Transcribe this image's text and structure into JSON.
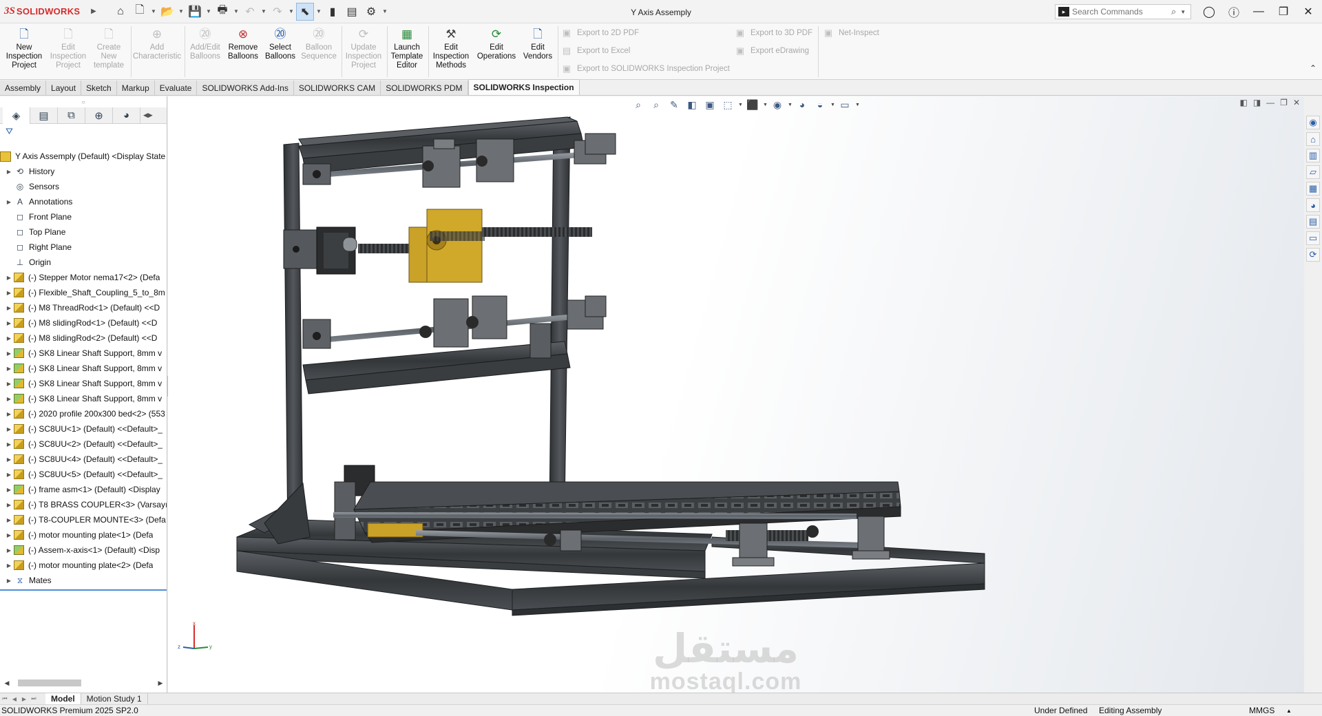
{
  "app": {
    "brand_ds": "3S",
    "brand_name": "SOLIDWORKS",
    "document_title": "Y Axis Assemply"
  },
  "search": {
    "placeholder": "Search Commands"
  },
  "ribbon": {
    "buttons": [
      {
        "label": "New Inspection Project",
        "icon": "new-inspection-project-icon",
        "enabled": true
      },
      {
        "label": "Edit Inspection Project",
        "icon": "edit-inspection-project-icon",
        "enabled": false
      },
      {
        "label": "Create New template",
        "icon": "create-template-icon",
        "enabled": false
      },
      {
        "label": "Add Characteristic",
        "icon": "add-characteristic-icon",
        "enabled": false
      },
      {
        "label": "Add/Edit Balloons",
        "icon": "balloon-icon",
        "enabled": false
      },
      {
        "label": "Remove Balloons",
        "icon": "remove-balloons-icon",
        "enabled": true
      },
      {
        "label": "Select Balloons",
        "icon": "select-balloons-icon",
        "enabled": true
      },
      {
        "label": "Balloon Sequence",
        "icon": "balloon-sequence-icon",
        "enabled": false
      },
      {
        "label": "Update Inspection Project",
        "icon": "update-project-icon",
        "enabled": false
      },
      {
        "label": "Launch Template Editor",
        "icon": "template-editor-icon",
        "enabled": true
      },
      {
        "label": "Edit Inspection Methods",
        "icon": "inspection-methods-icon",
        "enabled": true
      },
      {
        "label": "Edit Operations",
        "icon": "operations-icon",
        "enabled": true
      },
      {
        "label": "Edit Vendors",
        "icon": "vendors-icon",
        "enabled": true
      }
    ],
    "exports_col1": [
      "Export to 2D PDF",
      "Export to Excel",
      "Export to SOLIDWORKS Inspection Project"
    ],
    "exports_col2": [
      "Export to 3D PDF",
      "Export eDrawing"
    ],
    "net_inspect": "Net-Inspect"
  },
  "command_tabs": [
    "Assembly",
    "Layout",
    "Sketch",
    "Markup",
    "Evaluate",
    "SOLIDWORKS Add-Ins",
    "SOLIDWORKS CAM",
    "SOLIDWORKS PDM",
    "SOLIDWORKS Inspection"
  ],
  "active_command_tab": "SOLIDWORKS Inspection",
  "feature_tree": {
    "root": "Y Axis Assemply (Default) <Display State",
    "items": [
      {
        "label": "History",
        "icon": "history-icon",
        "expand": true,
        "type": "folder"
      },
      {
        "label": "Sensors",
        "icon": "sensor-icon",
        "expand": false,
        "type": "folder"
      },
      {
        "label": "Annotations",
        "icon": "annotation-icon",
        "expand": true,
        "type": "folder"
      },
      {
        "label": "Front Plane",
        "icon": "plane-icon",
        "expand": false,
        "type": "plane"
      },
      {
        "label": "Top Plane",
        "icon": "plane-icon",
        "expand": false,
        "type": "plane"
      },
      {
        "label": "Right Plane",
        "icon": "plane-icon",
        "expand": false,
        "type": "plane"
      },
      {
        "label": "Origin",
        "icon": "origin-icon",
        "expand": false,
        "type": "origin"
      },
      {
        "label": "(-) Stepper Motor nema17<2> (Defa",
        "icon": "assembly-icon",
        "expand": true,
        "type": "asm"
      },
      {
        "label": "(-) Flexible_Shaft_Coupling_5_to_8m",
        "icon": "part-icon",
        "expand": true,
        "type": "asm"
      },
      {
        "label": "(-) M8 ThreadRod<1> (Default) <<D",
        "icon": "part-icon",
        "expand": true,
        "type": "asm"
      },
      {
        "label": "(-) M8 slidingRod<1> (Default) <<D",
        "icon": "part-icon",
        "expand": true,
        "type": "asm"
      },
      {
        "label": "(-) M8 slidingRod<2> (Default) <<D",
        "icon": "part-icon",
        "expand": true,
        "type": "asm"
      },
      {
        "label": "(-) SK8 Linear Shaft Support, 8mm v",
        "icon": "assembly-icon",
        "expand": true,
        "type": "asmg"
      },
      {
        "label": "(-) SK8 Linear Shaft Support, 8mm v",
        "icon": "assembly-icon",
        "expand": true,
        "type": "asmg"
      },
      {
        "label": "(-) SK8 Linear Shaft Support, 8mm v",
        "icon": "assembly-icon",
        "expand": true,
        "type": "asmg"
      },
      {
        "label": "(-) SK8 Linear Shaft Support, 8mm v",
        "icon": "assembly-icon",
        "expand": true,
        "type": "asmg"
      },
      {
        "label": "(-) 2020 profile 200x300 bed<2> (553",
        "icon": "part-icon",
        "expand": true,
        "type": "asm"
      },
      {
        "label": "(-) SC8UU<1> (Default) <<Default>_",
        "icon": "part-icon",
        "expand": true,
        "type": "asm"
      },
      {
        "label": "(-) SC8UU<2> (Default) <<Default>_",
        "icon": "part-icon",
        "expand": true,
        "type": "asm"
      },
      {
        "label": "(-) SC8UU<4> (Default) <<Default>_",
        "icon": "part-icon",
        "expand": true,
        "type": "asm"
      },
      {
        "label": "(-) SC8UU<5> (Default) <<Default>_",
        "icon": "part-icon",
        "expand": true,
        "type": "asm"
      },
      {
        "label": "(-) frame asm<1> (Default) <Display",
        "icon": "assembly-icon",
        "expand": true,
        "type": "asmg"
      },
      {
        "label": "(-) T8 BRASS COUPLER<3> (Varsayıl",
        "icon": "part-icon",
        "expand": true,
        "type": "asm"
      },
      {
        "label": "(-) T8-COUPLER MOUNTE<3> (Defa",
        "icon": "part-icon",
        "expand": true,
        "type": "asm"
      },
      {
        "label": "(-) motor mounting plate<1> (Defa",
        "icon": "part-icon",
        "expand": true,
        "type": "asm"
      },
      {
        "label": "(-) Assem-x-axis<1> (Default) <Disp",
        "icon": "assembly-icon",
        "expand": true,
        "type": "asmg"
      },
      {
        "label": "(-) motor mounting plate<2> (Defa",
        "icon": "part-icon",
        "expand": true,
        "type": "asm"
      },
      {
        "label": "Mates",
        "icon": "mates-icon",
        "expand": true,
        "type": "mates"
      }
    ]
  },
  "bottom_tabs": [
    "Model",
    "Motion Study 1"
  ],
  "active_bottom_tab": "Model",
  "status": {
    "version": "SOLIDWORKS Premium 2025 SP2.0",
    "definition": "Under Defined",
    "mode": "Editing Assembly",
    "units": "MMGS"
  },
  "watermark": {
    "arabic": "مستقل",
    "latin": "mostaql.com"
  },
  "triad": {
    "x": "x",
    "y": "y",
    "z": "z"
  },
  "colors": {
    "brand_red": "#d62a2a",
    "profile_dark": "#3a3d40",
    "brass_mount": "#c9a227",
    "selection_blue": "#4d8fd6"
  }
}
